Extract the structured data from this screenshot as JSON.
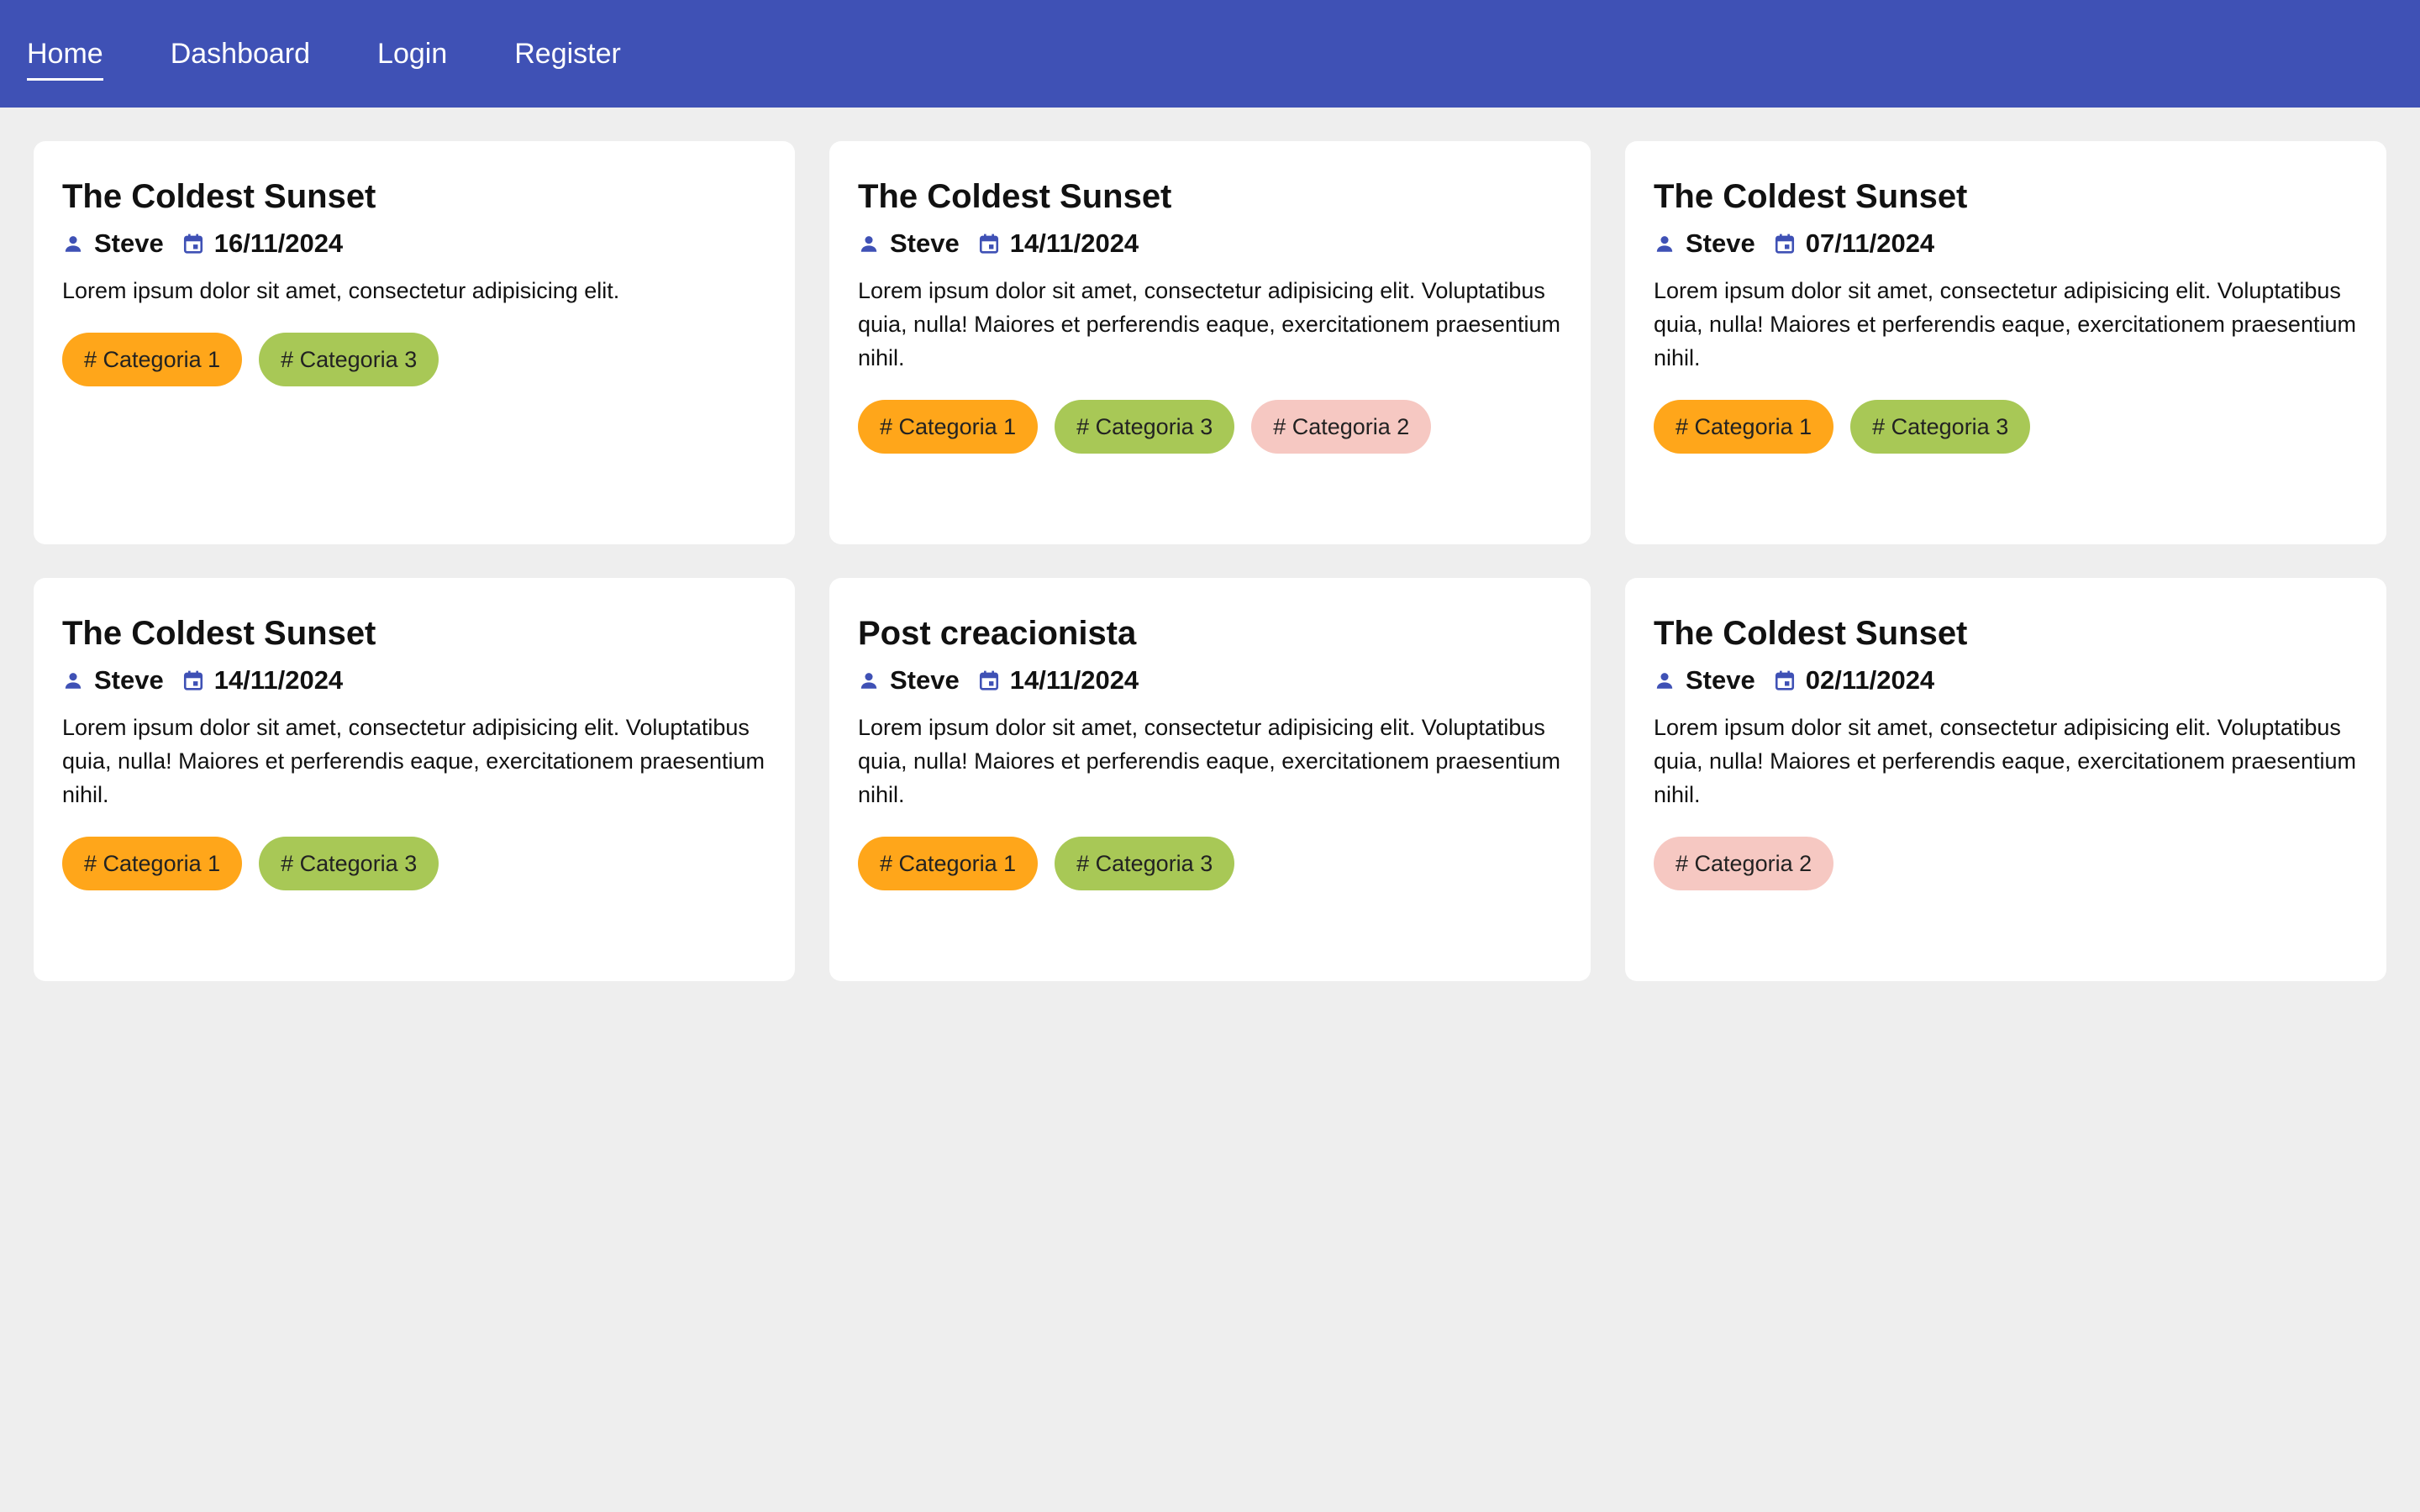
{
  "nav": {
    "items": [
      {
        "label": "Home",
        "active": true
      },
      {
        "label": "Dashboard",
        "active": false
      },
      {
        "label": "Login",
        "active": false
      },
      {
        "label": "Register",
        "active": false
      }
    ]
  },
  "colors": {
    "primary": "#3f51b5",
    "background": "#eeeeee",
    "Categoria 1": "#ffa61a",
    "Categoria 2": "#f6c8c2",
    "Categoria 3": "#a8c856"
  },
  "posts": [
    {
      "title": "The Coldest Sunset",
      "author": "Steve",
      "date": "16/11/2024",
      "excerpt": "Lorem ipsum dolor sit amet, consectetur adipisicing elit.",
      "tags": [
        "# Categoria 1",
        "# Categoria 3"
      ]
    },
    {
      "title": "The Coldest Sunset",
      "author": "Steve",
      "date": "14/11/2024",
      "excerpt": "Lorem ipsum dolor sit amet, consectetur adipisicing elit. Voluptatibus quia, nulla! Maiores et perferendis eaque, exercitationem praesentium nihil.",
      "tags": [
        "# Categoria 1",
        "# Categoria 3",
        "# Categoria 2"
      ]
    },
    {
      "title": "The Coldest Sunset",
      "author": "Steve",
      "date": "07/11/2024",
      "excerpt": "Lorem ipsum dolor sit amet, consectetur adipisicing elit. Voluptatibus quia, nulla! Maiores et perferendis eaque, exercitationem praesentium nihil.",
      "tags": [
        "# Categoria 1",
        "# Categoria 3"
      ]
    },
    {
      "title": "The Coldest Sunset",
      "author": "Steve",
      "date": "14/11/2024",
      "excerpt": "Lorem ipsum dolor sit amet, consectetur adipisicing elit. Voluptatibus quia, nulla! Maiores et perferendis eaque, exercitationem praesentium nihil.",
      "tags": [
        "# Categoria 1",
        "# Categoria 3"
      ]
    },
    {
      "title": "Post creacionista",
      "author": "Steve",
      "date": "14/11/2024",
      "excerpt": "Lorem ipsum dolor sit amet, consectetur adipisicing elit. Voluptatibus quia, nulla! Maiores et perferendis eaque, exercitationem praesentium nihil.",
      "tags": [
        "# Categoria 1",
        "# Categoria 3"
      ]
    },
    {
      "title": "The Coldest Sunset",
      "author": "Steve",
      "date": "02/11/2024",
      "excerpt": "Lorem ipsum dolor sit amet, consectetur adipisicing elit. Voluptatibus quia, nulla! Maiores et perferendis eaque, exercitationem praesentium nihil.",
      "tags": [
        "# Categoria 2"
      ]
    }
  ]
}
